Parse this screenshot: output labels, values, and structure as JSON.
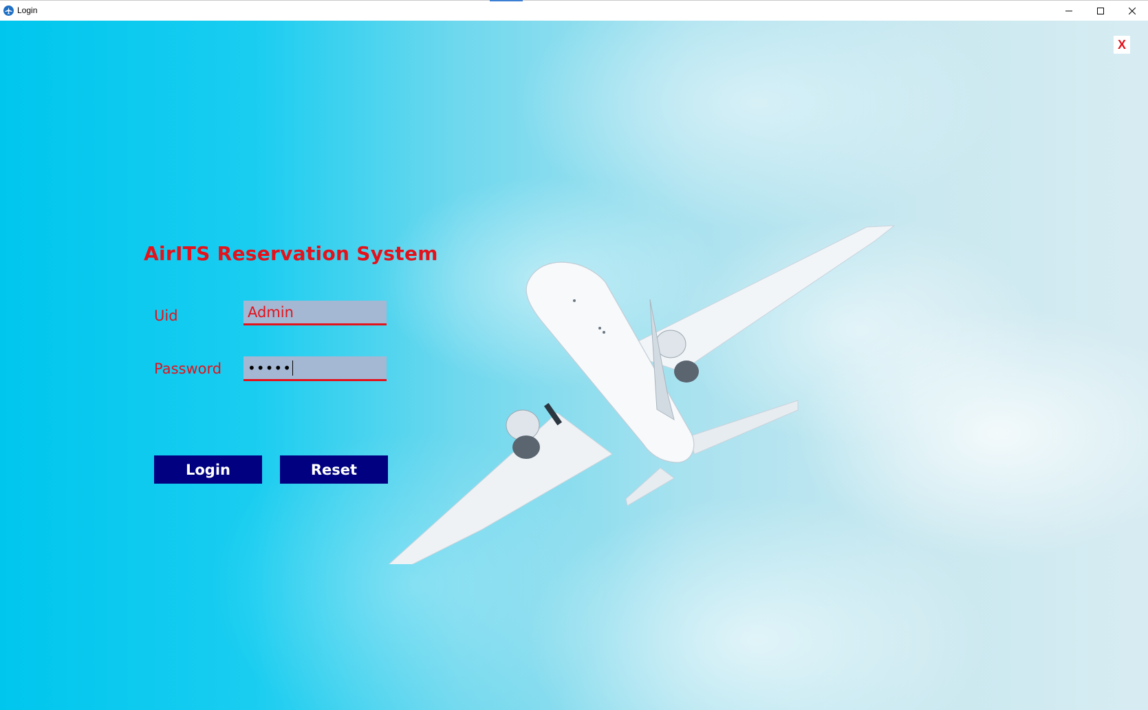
{
  "window": {
    "title": "Login",
    "controls": {
      "minimize": "minimize-icon",
      "maximize": "maximize-icon",
      "close": "close-icon"
    }
  },
  "form": {
    "heading": "AirITS Reservation System",
    "close_label": "X",
    "uid_label": "Uid",
    "uid_value": "Admin",
    "password_label": "Password",
    "password_value": "•••••",
    "login_button": "Login",
    "reset_button": "Reset"
  },
  "colors": {
    "accent_red": "#e3121b",
    "button_navy": "#000080",
    "field_bg": "#a4b7d3",
    "sky": "#00c6ee"
  }
}
